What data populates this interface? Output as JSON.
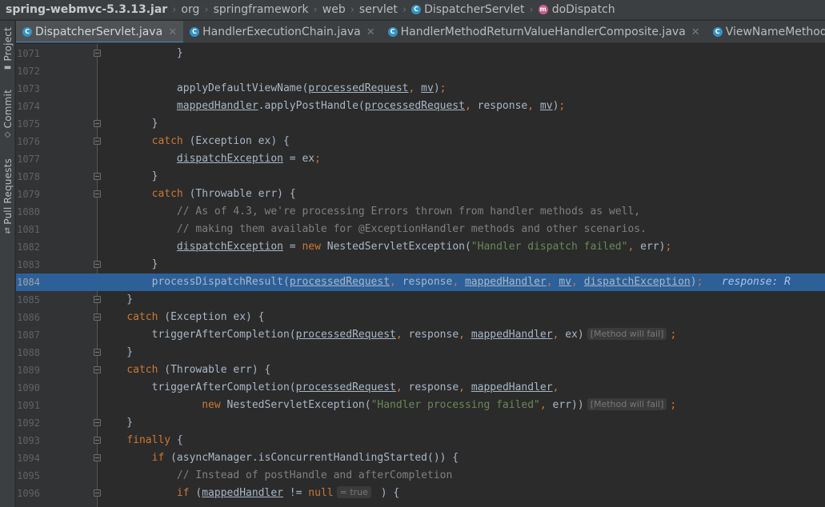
{
  "breadcrumb": {
    "jar": "spring-webmvc-5.3.13.jar",
    "items": [
      "org",
      "springframework",
      "web",
      "servlet"
    ],
    "class_name": "DispatcherServlet",
    "method_name": "doDispatch"
  },
  "side_tabs": {
    "project": "Project",
    "commit": "Commit",
    "pull_requests": "Pull Requests"
  },
  "tabs": [
    {
      "label": "DispatcherServlet.java",
      "active": true
    },
    {
      "label": "HandlerExecutionChain.java",
      "active": false
    },
    {
      "label": "HandlerMethodReturnValueHandlerComposite.java",
      "active": false
    },
    {
      "label": "ViewNameMethodReturnValueHandler.java",
      "active": false
    }
  ],
  "editor": {
    "current_line": "1084",
    "lines": [
      {
        "n": "1071",
        "code": "            }"
      },
      {
        "n": "1072",
        "code": ""
      },
      {
        "n": "1073",
        "code": "            applyDefaultViewName(processedRequest, mv);"
      },
      {
        "n": "1074",
        "code": "            mappedHandler.applyPostHandle(processedRequest, response, mv);"
      },
      {
        "n": "1075",
        "code": "        }"
      },
      {
        "n": "1076",
        "code": "        catch (Exception ex) {"
      },
      {
        "n": "1077",
        "code": "            dispatchException = ex;"
      },
      {
        "n": "1078",
        "code": "        }"
      },
      {
        "n": "1079",
        "code": "        catch (Throwable err) {"
      },
      {
        "n": "1080",
        "code": "            // As of 4.3, we're processing Errors thrown from handler methods as well,"
      },
      {
        "n": "1081",
        "code": "            // making them available for @ExceptionHandler methods and other scenarios."
      },
      {
        "n": "1082",
        "code": "            dispatchException = new NestedServletException(\"Handler dispatch failed\", err);"
      },
      {
        "n": "1083",
        "code": "        }"
      },
      {
        "n": "1084",
        "code": "        processDispatchResult(processedRequest, response, mappedHandler, mv, dispatchException);",
        "inline": "response: R"
      },
      {
        "n": "1085",
        "code": "    }"
      },
      {
        "n": "1086",
        "code": "    catch (Exception ex) {"
      },
      {
        "n": "1087",
        "code": "        triggerAfterCompletion(processedRequest, response, mappedHandler, ex)",
        "hint": "[Method will fail]"
      },
      {
        "n": "1088",
        "code": "    }"
      },
      {
        "n": "1089",
        "code": "    catch (Throwable err) {"
      },
      {
        "n": "1090",
        "code": "        triggerAfterCompletion(processedRequest, response, mappedHandler,"
      },
      {
        "n": "1091",
        "code": "                new NestedServletException(\"Handler processing failed\", err))",
        "hint": "[Method will fail]"
      },
      {
        "n": "1092",
        "code": "    }"
      },
      {
        "n": "1093",
        "code": "    finally {"
      },
      {
        "n": "1094",
        "code": "        if (asyncManager.isConcurrentHandlingStarted()) {"
      },
      {
        "n": "1095",
        "code": "            // Instead of postHandle and afterCompletion"
      },
      {
        "n": "1096",
        "code": "            if (mappedHandler != null",
        "hint": "= true"
      }
    ]
  },
  "colors": {
    "background": "#2b2b2b",
    "keyword": "#cc7832",
    "comment": "#808080",
    "string": "#6a8759",
    "identifier": "#a9b7c6",
    "execution_line": "#2d6099"
  }
}
